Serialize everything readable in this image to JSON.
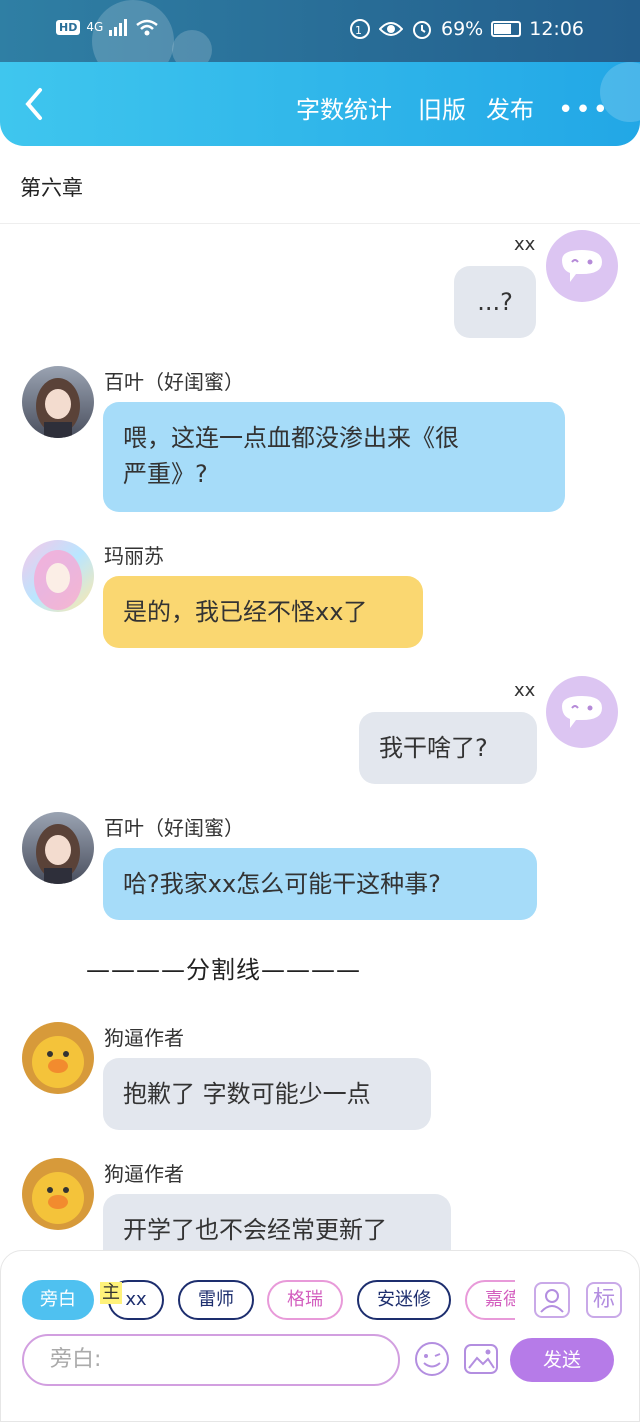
{
  "status_bar": {
    "hd": "HD",
    "network": "4G",
    "battery_text": "69%",
    "battery_level": 0.69,
    "time": "12:06"
  },
  "header": {
    "buttons": [
      "字数统计",
      "旧版",
      "发布"
    ],
    "more": "•••"
  },
  "chapter_title": "第六章",
  "messages": [
    {
      "side": "right",
      "name": "xx",
      "text": "...?"
    },
    {
      "side": "left",
      "name": "百叶（好闺蜜）",
      "text_lines": [
        "喂，这连一点血都没渗出来《很",
        "严重》?"
      ]
    },
    {
      "side": "left",
      "name": "玛丽苏",
      "text": "是的，我已经不怪xx了"
    },
    {
      "side": "right",
      "name": "xx",
      "text": "我干啥了?"
    },
    {
      "side": "left",
      "name": "百叶（好闺蜜）",
      "text": "哈?我家xx怎么可能干这种事?"
    },
    {
      "divider": "————分割线————"
    },
    {
      "side": "left",
      "name": "狗逼作者",
      "text": "抱歉了 字数可能少一点"
    },
    {
      "side": "left",
      "name": "狗逼作者",
      "text": "开学了也不会经常更新了"
    }
  ],
  "bottom": {
    "chips": [
      "旁白",
      "xx",
      "雷师",
      "格瑞",
      "安迷修",
      "嘉德"
    ],
    "main_tag": "主",
    "tag_button": "标",
    "input_placeholder": "旁白:",
    "send_label": "发送"
  },
  "colors": {
    "header_accent": "#22a7e6",
    "bubble_blue": "#a6dcf9",
    "bubble_gray": "#e3e7ee",
    "bubble_yellow": "#fad771",
    "send_purple": "#b67be8"
  }
}
